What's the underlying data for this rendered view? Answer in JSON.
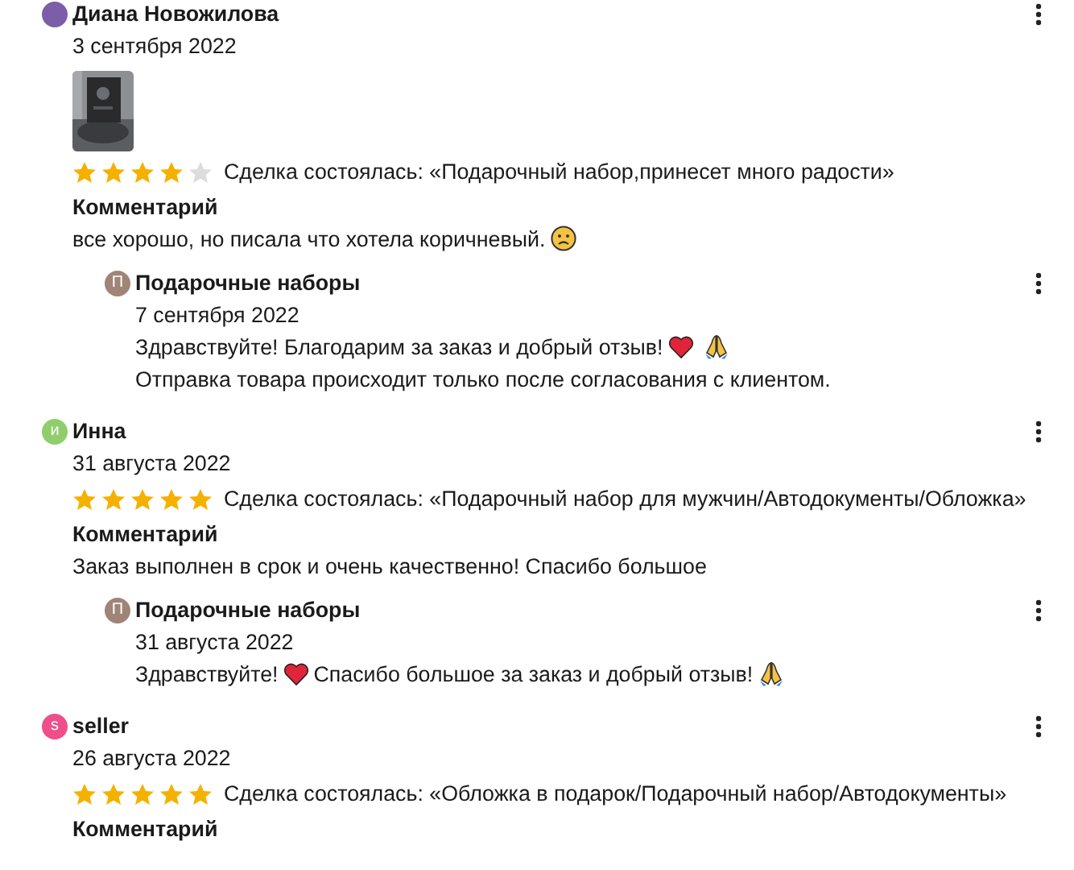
{
  "reviews": [
    {
      "author": "Диана Новожилова",
      "avatar": {
        "color": "#7b5ea7"
      },
      "date": "3 сентября 2022",
      "photos": [
        {
          "kind": "picture"
        }
      ],
      "stars": 4,
      "deal": "Сделка состоялась: «Подарочный набор,принесет много радости»",
      "comment_label": "Комментарий",
      "comment": [
        {
          "kind": "text",
          "text": "все хорошо, но писала что хотела коричневый."
        },
        {
          "kind": "sad"
        }
      ],
      "reply": {
        "author": "Подарочные наборы",
        "avatar": {
          "letter": "П",
          "color": "#a08478"
        },
        "date": "7 сентября 2022",
        "lines": [
          [
            {
              "kind": "text",
              "text": "Здравствуйте! Благодарим за заказ и добрый отзыв!"
            },
            {
              "kind": "heart"
            },
            {
              "kind": "pray"
            }
          ],
          [
            {
              "kind": "text",
              "text": "Отправка товара происходит только после согласования с клиентом."
            }
          ]
        ]
      }
    },
    {
      "author": "Инна",
      "avatar": {
        "letter": "и",
        "color": "#8fce6a"
      },
      "date": "31 августа 2022",
      "stars": 5,
      "deal": "Сделка состоялась: «Подарочный набор для мужчин/Автодокументы/Обложка»",
      "comment_label": "Комментарий",
      "comment": [
        {
          "kind": "text",
          "text": "Заказ выполнен в срок и очень качественно! Спасибо большое"
        }
      ],
      "reply": {
        "author": "Подарочные наборы",
        "avatar": {
          "letter": "П",
          "color": "#a08478"
        },
        "date": "31 августа 2022",
        "lines": [
          [
            {
              "kind": "text",
              "text": "Здравствуйте!"
            },
            {
              "kind": "heart"
            },
            {
              "kind": "text",
              "text": "Спасибо большое за заказ и добрый отзыв!"
            },
            {
              "kind": "pray"
            }
          ]
        ]
      }
    },
    {
      "author": "seller",
      "avatar": {
        "letter": "s",
        "color": "#ee4f8a"
      },
      "date": "26 августа 2022",
      "stars": 5,
      "deal": "Сделка состоялась: «Обложка в подарок/Подарочный набор/Автодокументы»",
      "comment_label": "Комментарий"
    }
  ]
}
